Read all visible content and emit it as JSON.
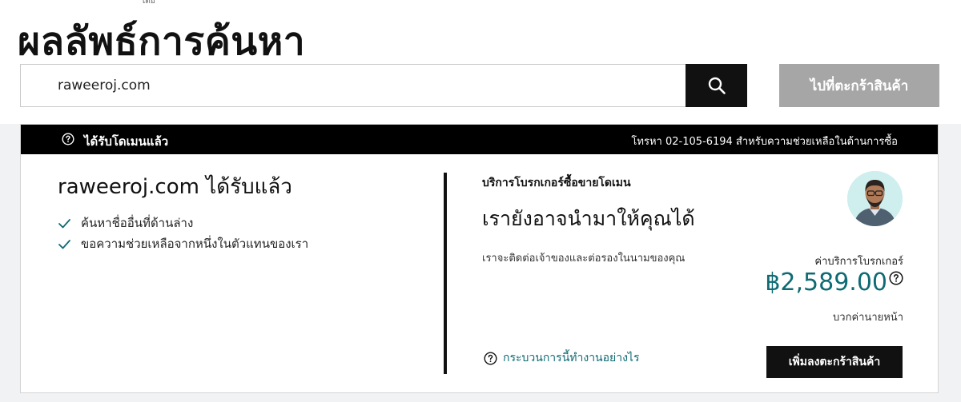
{
  "header": {
    "crumb": "โดย",
    "title": "ผลลัพธ์การค้นหา"
  },
  "search": {
    "value": "raweeroj.com",
    "search_icon": "search-icon",
    "cart_button_label": "ไปที่ตะกร้าสินค้า"
  },
  "result": {
    "header_icon": "help-circle-icon",
    "header_title": "ได้รับโดเมนแล้ว",
    "header_phone": "โทรหา 02-105-6194 สำหรับความช่วยเหลือในด้านการซื้อ",
    "domain_title": "raweeroj.com ได้รับแล้ว",
    "checklist": [
      "ค้นหาชื่ออื่นที่ด้านล่าง",
      "ขอความช่วยเหลือจากหนึ่งในตัวแทนของเรา"
    ],
    "broker_label": "บริการโบรกเกอร์ซื้อขายโดเมน",
    "broker_headline": "เรายังอาจนำมาให้คุณได้",
    "broker_desc": "เราจะติดต่อเจ้าของและต่อรองในนามของคุณ",
    "fee_label": "ค่าบริการโบรกเกอร์",
    "fee_price": "฿2,589.00",
    "fee_sub": "บวกค่านายหน้า",
    "how_link": "กระบวนการนี้ทำงานอย่างไร",
    "add_cart_label": "เพิ่มลงตะกร้าสินค้า"
  },
  "colors": {
    "accent_teal": "#0f6b73",
    "header_black": "#000000",
    "cart_disabled_gray": "#a6a6a6",
    "avatar_bg": "#cfeeee"
  }
}
